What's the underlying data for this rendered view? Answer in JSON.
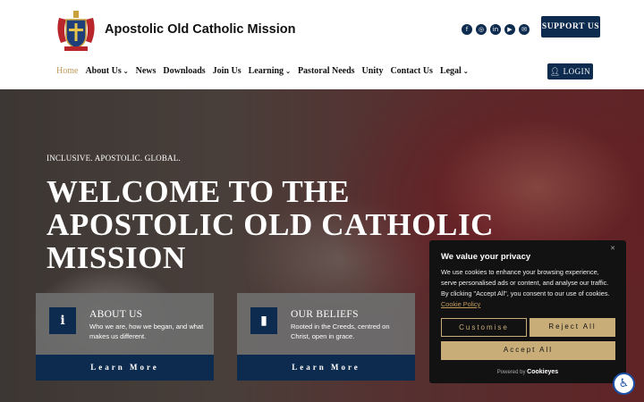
{
  "header": {
    "site_title": "Apostolic Old Catholic Mission",
    "support_label": "SUPPORT US",
    "login_label": "LOGIN",
    "socials": [
      "facebook-icon",
      "instagram-icon",
      "linkedin-icon",
      "youtube-icon",
      "email-icon"
    ]
  },
  "nav": {
    "items": [
      {
        "label": "Home",
        "active": true
      },
      {
        "label": "About Us",
        "dropdown": true
      },
      {
        "label": "News"
      },
      {
        "label": "Downloads"
      },
      {
        "label": "Join Us"
      },
      {
        "label": "Learning",
        "dropdown": true
      },
      {
        "label": "Pastoral Needs"
      },
      {
        "label": "Unity"
      },
      {
        "label": "Contact Us"
      },
      {
        "label": "Legal",
        "dropdown": true
      }
    ]
  },
  "hero": {
    "tagline": "INCLUSIVE. APOSTOLIC. GLOBAL.",
    "headline": "WELCOME TO THE APOSTOLIC OLD CATHOLIC MISSION"
  },
  "cards": [
    {
      "title": "ABOUT US",
      "desc": "Who we are, how we began, and what makes us different.",
      "button": "Learn More",
      "icon": "info-icon"
    },
    {
      "title": "OUR BELIEFS",
      "desc": "Rooted in the Creeds, centred on Christ, open in grace.",
      "button": "Learn More",
      "icon": "book-icon"
    }
  ],
  "cookie": {
    "title": "We value your privacy",
    "text": "We use cookies to enhance your browsing experience, serve personalised ads or content, and analyse our traffic. By clicking \"Accept All\", you consent to our use of cookies.",
    "link": "Cookie Policy",
    "customise": "Customise",
    "reject": "Reject All",
    "accept": "Accept All",
    "powered_by": "Powered by",
    "powered_brand": "Cookieyes"
  },
  "colors": {
    "navy": "#0d2b4e",
    "gold": "#c9ad79",
    "nav_active": "#c19a5b"
  }
}
